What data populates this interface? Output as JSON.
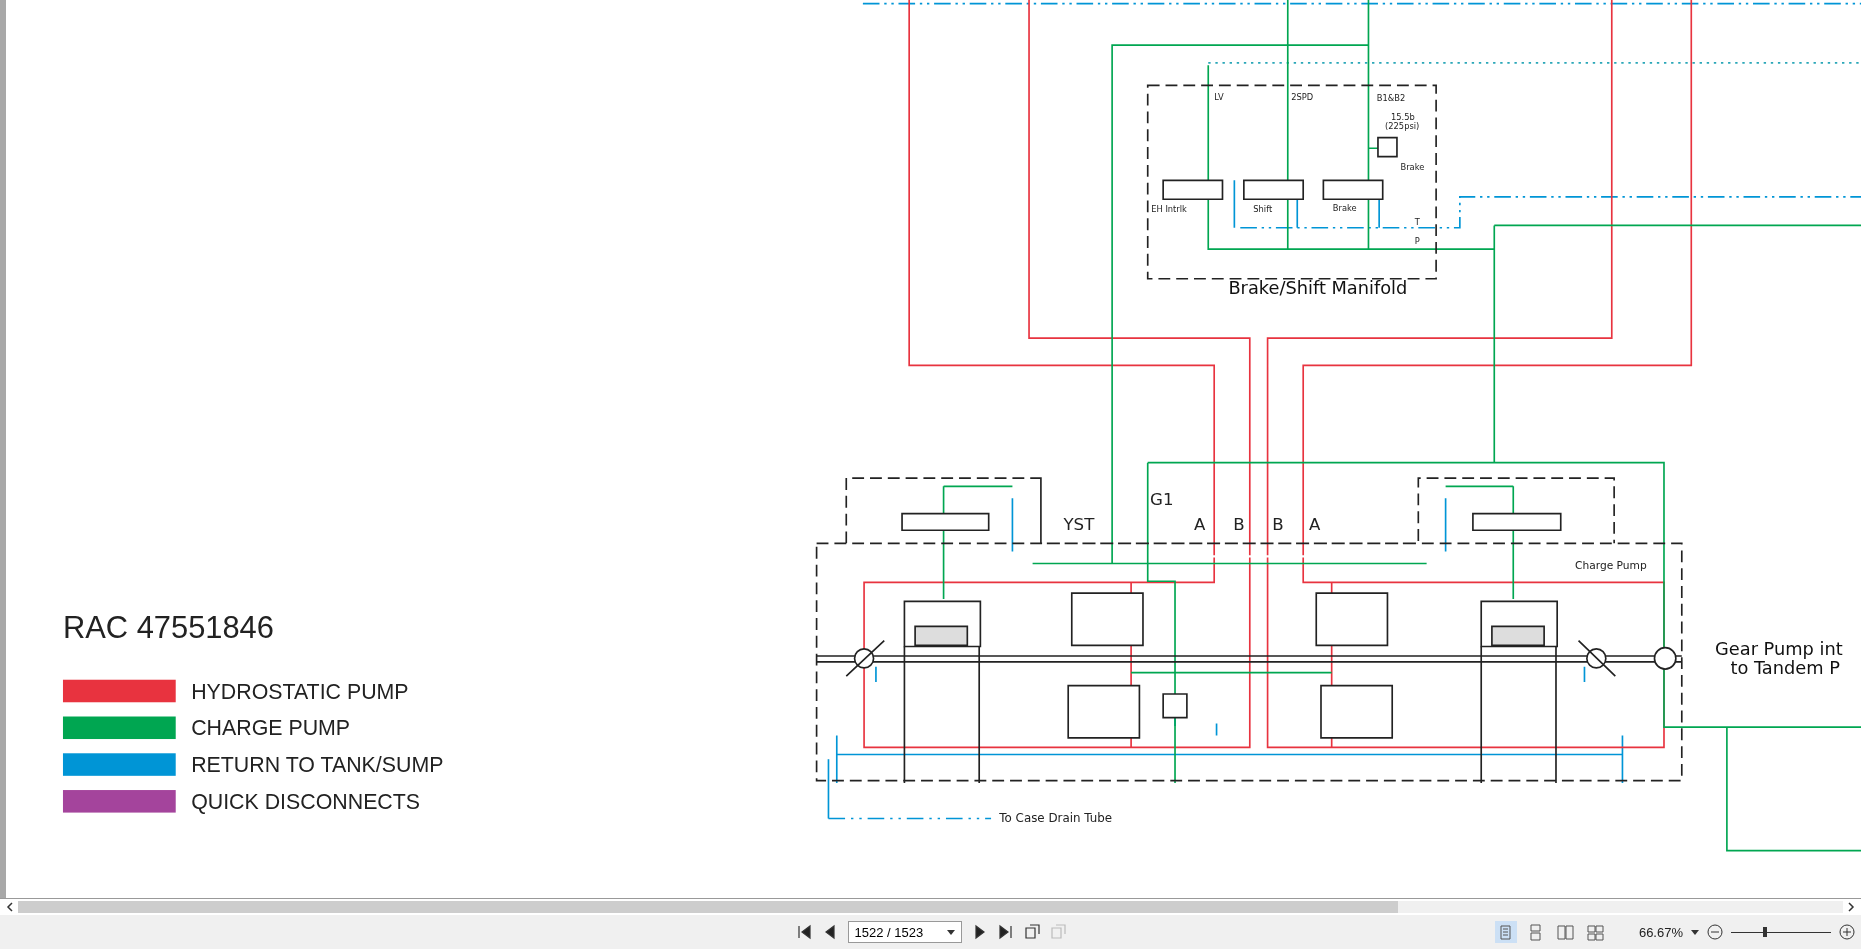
{
  "document": {
    "title": "RAC 47551846",
    "legend": [
      {
        "label": "HYDROSTATIC PUMP",
        "color": "#e8333f"
      },
      {
        "label": "CHARGE PUMP",
        "color": "#00a651"
      },
      {
        "label": "RETURN TO TANK/SUMP",
        "color": "#0095d6"
      },
      {
        "label": "QUICK DISCONNECTS",
        "color": "#a4449c"
      }
    ],
    "schematic_labels": [
      {
        "text": "LV"
      },
      {
        "text": "2SPD"
      },
      {
        "text": "B1&B2"
      },
      {
        "text": "15.5b"
      },
      {
        "text": "(225psi)"
      },
      {
        "text": "Brake"
      },
      {
        "text": "EH Intrlk"
      },
      {
        "text": "Shift"
      },
      {
        "text": "Brake"
      },
      {
        "text": "T"
      },
      {
        "text": "P"
      },
      {
        "text": "Brake/Shift Manifold"
      },
      {
        "text": "YST"
      },
      {
        "text": "G1"
      },
      {
        "text": "A"
      },
      {
        "text": "B"
      },
      {
        "text": "B"
      },
      {
        "text": "A"
      },
      {
        "text": "Charge Pump"
      },
      {
        "text": "Gear Pump int"
      },
      {
        "text": "to Tandem P"
      },
      {
        "text": "To Case Drain Tube"
      }
    ]
  },
  "toolbar": {
    "nav_buttons": [
      {
        "kind": "first",
        "disabled": false
      },
      {
        "kind": "prev",
        "disabled": false
      },
      {
        "kind": "next",
        "disabled": false
      },
      {
        "kind": "last",
        "disabled": false
      },
      {
        "kind": "back-view",
        "disabled": false
      },
      {
        "kind": "forward-view",
        "disabled": true
      }
    ],
    "page_field": "1522 / 1523",
    "view_buttons": [
      {
        "kind": "single",
        "selected": true
      },
      {
        "kind": "continuous",
        "selected": false
      },
      {
        "kind": "facing",
        "selected": false
      },
      {
        "kind": "continuous-facing",
        "selected": false
      }
    ],
    "zoom": {
      "value": "66.67%",
      "level": 0.34
    }
  }
}
